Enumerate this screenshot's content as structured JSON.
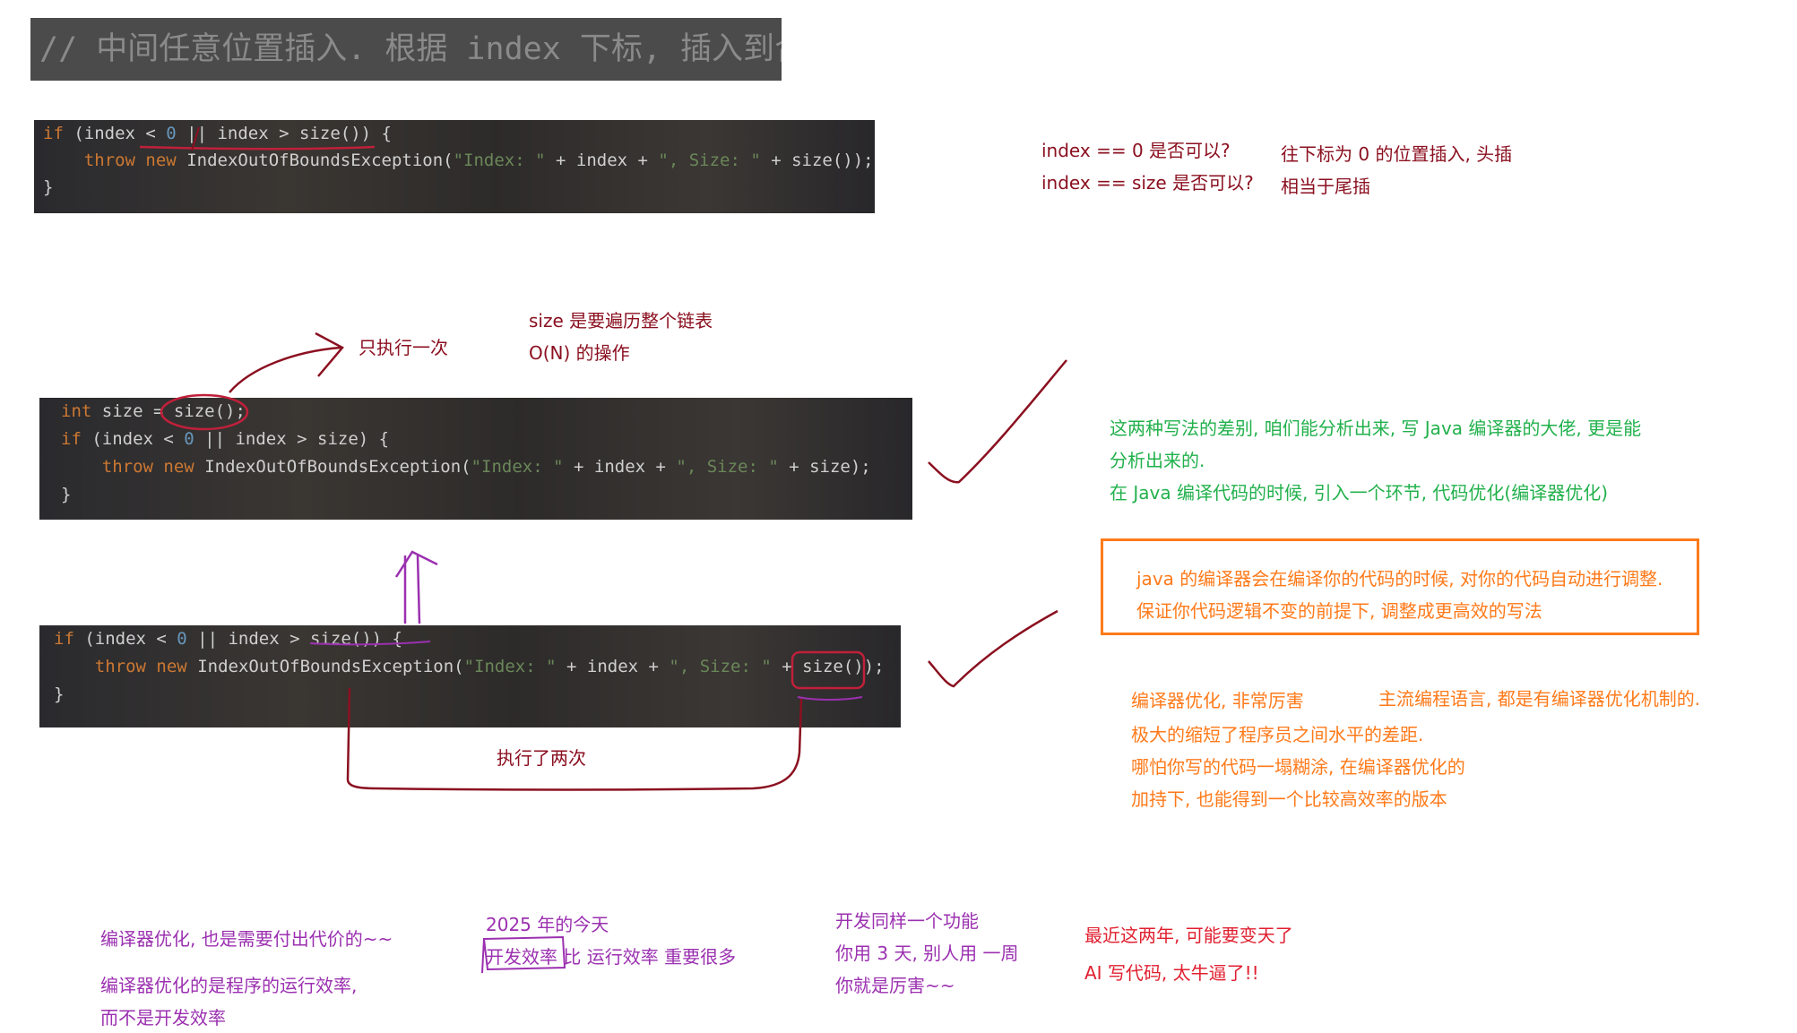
{
  "banner": "// 中间任意位置插入. 根据 index 下标, 插入到合适的位置上.",
  "code1": {
    "l1": [
      "if",
      " (index < ",
      "0",
      " || index > size()) {"
    ],
    "l2": [
      "    ",
      "throw",
      " ",
      "new",
      " IndexOutOfBoundsException(",
      "\"Index: \"",
      " + index + ",
      "\", Size: \"",
      " + size());"
    ],
    "l3": "}"
  },
  "code2": {
    "l1": [
      "int",
      " size = size();"
    ],
    "l2": [
      "if",
      " (index < ",
      "0",
      " || index > size) {"
    ],
    "l3": [
      "    ",
      "throw",
      " ",
      "new",
      " IndexOutOfBoundsException(",
      "\"Index: \"",
      " + index + ",
      "\", Size: \"",
      " + size);"
    ],
    "l4": "}"
  },
  "code3": {
    "l1": [
      "if",
      " (index < ",
      "0",
      " || index > size()) {"
    ],
    "l2": [
      "    ",
      "throw",
      " ",
      "new",
      " IndexOutOfBoundsException(",
      "\"Index: \"",
      " + index + ",
      "\", Size: \"",
      " + size());"
    ],
    "l3": "}"
  },
  "notes": {
    "q1": "index == 0 是否可以?",
    "q2": "index == size 是否可以?",
    "a1": "往下标为 0 的位置插入, 头插",
    "a2": "相当于尾插",
    "once": "只执行一次",
    "size1": "size 是要遍历整个链表",
    "size2": "O(N) 的操作",
    "twice": "执行了两次",
    "g1": "这两种写法的差别, 咱们能分析出来, 写 Java 编译器的大佬, 更是能",
    "g2": "分析出来的.",
    "g3": "在 Java 编译代码的时候, 引入一个环节, 代码优化(编译器优化)",
    "box1": "java 的编译器会在编译你的代码的时候, 对你的代码自动进行调整.",
    "box2": "保证你代码逻辑不变的前提下, 调整成更高效的写法",
    "o1": "编译器优化, 非常厉害",
    "o1b": "主流编程语言, 都是有编译器优化机制的.",
    "o2": "极大的缩短了程序员之间水平的差距.",
    "o3": "哪怕你写的代码一塌糊涂, 在编译器优化的",
    "o4": "加持下, 也能得到一个比较高效率的版本",
    "p1": "编译器优化, 也是需要付出代价的~~",
    "p2": "编译器优化的是程序的运行效率,",
    "p3": "而不是开发效率",
    "p4": "2025 年的今天",
    "p5a": "开发效率",
    "p5b": " 比 运行效率 重要很多",
    "p6": "开发同样一个功能",
    "p7": "你用 3 天, 别人用 一周",
    "p8": "你就是厉害~~",
    "r1": "最近这两年, 可能要变天了",
    "r2": "AI 写代码, 太牛逼了!!"
  }
}
